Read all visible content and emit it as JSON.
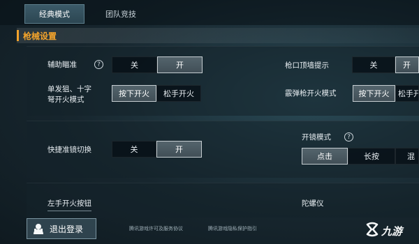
{
  "tabs": [
    {
      "label": "经典模式"
    },
    {
      "label": "团队竞技"
    }
  ],
  "section": {
    "title": "枪械设置"
  },
  "settings": {
    "aim_assist": {
      "label": "辅助瞄准",
      "help": "?",
      "options": [
        "关",
        "开"
      ],
      "selected": "开"
    },
    "wall_hint": {
      "label": "枪口顶墙提示",
      "options": [
        "关",
        "开"
      ],
      "selected": "开"
    },
    "single_fire": {
      "label_line1": "单发狙、十字",
      "label_line2": "弩开火模式",
      "options": [
        "按下开火",
        "松手开火"
      ],
      "selected": "按下开火"
    },
    "shotgun_fire": {
      "label": "霰弹枪开火模式",
      "options": [
        "按下开火",
        "松手开火"
      ],
      "selected": "按下开火"
    },
    "scope_switch": {
      "label": "快捷准镜切换",
      "options": [
        "关",
        "开"
      ],
      "selected": "开"
    },
    "scope_mode": {
      "label": "开镜模式",
      "help": "?",
      "options": [
        "点击",
        "长按",
        "混"
      ],
      "selected": "点击"
    },
    "left_fire": {
      "label": "左手开火按钮"
    },
    "gyro": {
      "label": "陀螺仪"
    }
  },
  "footer": {
    "logout_label": "退出登录",
    "links": [
      "腾讯游戏许可及服务协议",
      "腾讯游戏隐私保护指引"
    ],
    "brand": "九游"
  },
  "colors": {
    "accent": "#f3a32b",
    "selected_bg": "#4b5a62",
    "background": "#17262e"
  }
}
